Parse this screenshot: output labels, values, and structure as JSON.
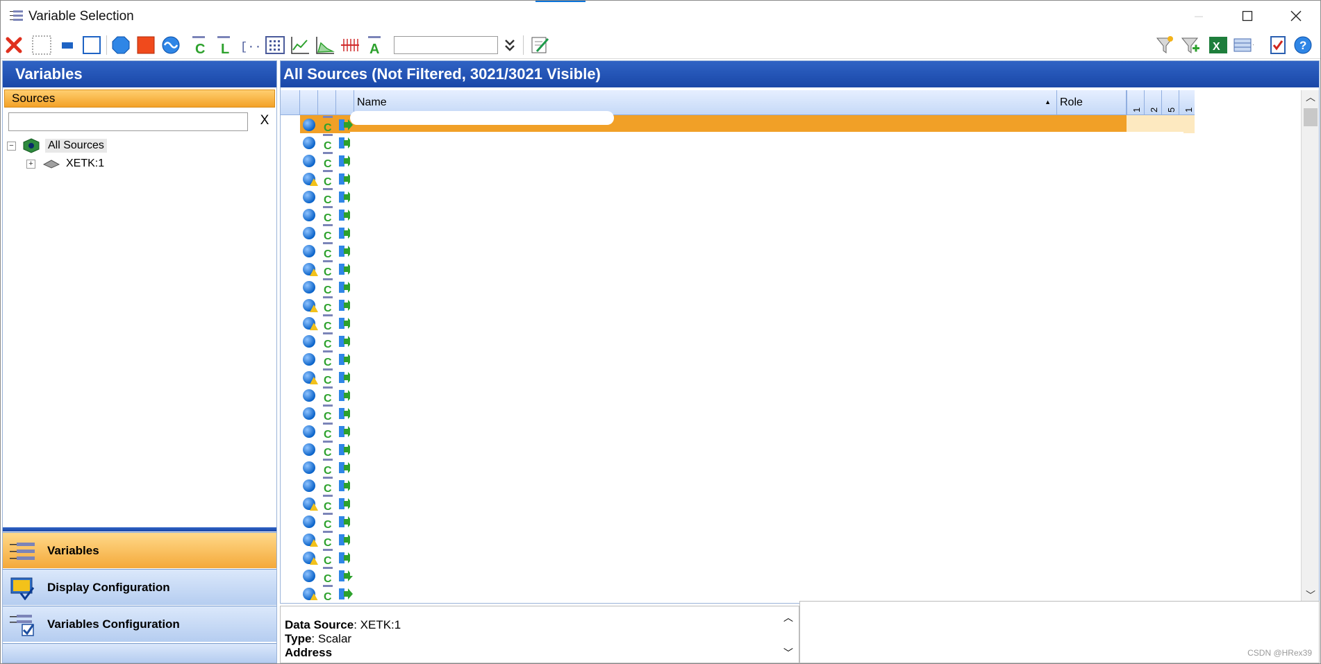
{
  "window": {
    "title": "Variable Selection"
  },
  "toolbar": {
    "search_value": ""
  },
  "left": {
    "header": "Variables",
    "sources_label": "Sources",
    "search_value": "",
    "clear_label": "X",
    "tree": [
      {
        "label": "All Sources",
        "expander": "−"
      },
      {
        "label": "XETK:1",
        "expander": "+"
      }
    ],
    "nav": [
      {
        "label": "Variables"
      },
      {
        "label": "Display Configuration"
      },
      {
        "label": "Variables Configuration"
      }
    ]
  },
  "right": {
    "header": "All Sources (Not Filtered, 3021/3021 Visible)",
    "columns": {
      "name": "Name",
      "role": "Role",
      "v1": "1",
      "v2": "2",
      "v3": "5",
      "v4": "1"
    },
    "row_warn_flags": [
      0,
      0,
      0,
      1,
      0,
      0,
      0,
      0,
      1,
      0,
      1,
      1,
      0,
      0,
      1,
      0,
      0,
      0,
      0,
      0,
      0,
      1,
      0,
      1,
      1,
      0,
      1,
      0,
      0
    ]
  },
  "details": {
    "data_source_label": "Data Source",
    "data_source_value": ": XETK:1",
    "type_label": "Type",
    "type_value": ": Scalar",
    "address_label": "Address"
  },
  "watermark": "CSDN @HRex39",
  "colors": {
    "header_blue": "#1a47a8",
    "selection_orange": "#f1a027"
  }
}
